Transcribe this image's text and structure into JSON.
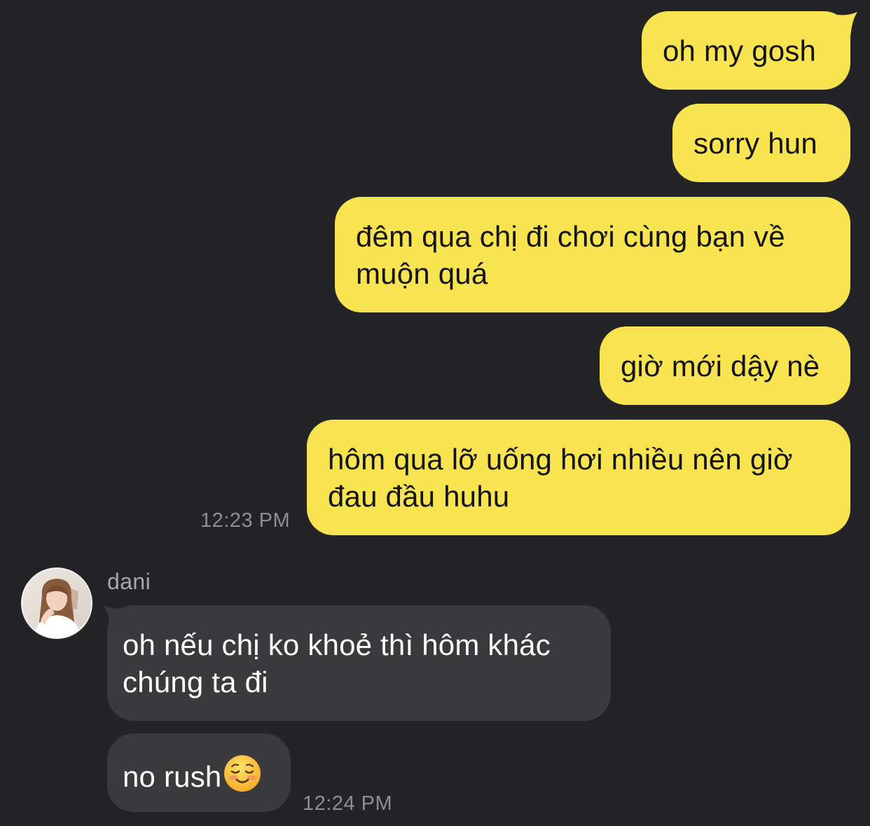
{
  "conversation": {
    "outgoing": [
      {
        "text": "oh my gosh"
      },
      {
        "text": "sorry hun"
      },
      {
        "line1": "đêm qua chị đi chơi cùng bạn về",
        "line2": "muộn quá"
      },
      {
        "text": "giờ mới dậy nè"
      },
      {
        "line1": "hôm qua lỡ uống hơi nhiều nên giờ",
        "line2": "đau đầu huhu"
      }
    ],
    "outgoing_time": "12:23 PM",
    "contact": {
      "name": "dani",
      "avatar_icon": "user-avatar-photo"
    },
    "incoming": [
      {
        "line1": "oh nếu chị ko khoẻ thì hôm khác",
        "line2": "chúng ta đi"
      },
      {
        "text": "no rush",
        "emoji": "smiling-face-icon"
      }
    ],
    "incoming_time": "12:24 PM"
  },
  "colors": {
    "background": "#242426",
    "outgoing_bubble": "#f8e450",
    "incoming_bubble": "#3a3a3c",
    "timestamp": "#8e8e92"
  }
}
